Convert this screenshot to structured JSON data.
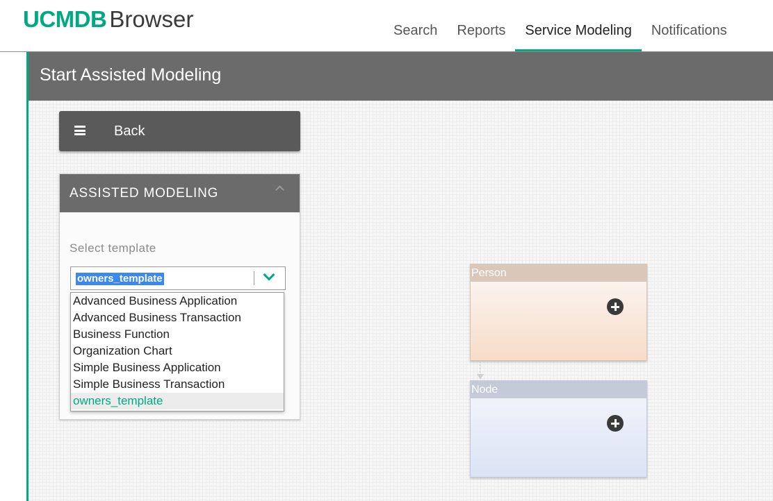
{
  "app": {
    "brand": "UCMDB",
    "product": "Browser"
  },
  "nav": {
    "items": [
      {
        "label": "Search",
        "active": false
      },
      {
        "label": "Reports",
        "active": false
      },
      {
        "label": "Service Modeling",
        "active": true
      },
      {
        "label": "Notifications",
        "active": false
      }
    ]
  },
  "page": {
    "title": "Start Assisted Modeling"
  },
  "back_button": {
    "label": "Back",
    "icon": "hamburger-icon"
  },
  "panel": {
    "title": "ASSISTED MODELING",
    "collapse_icon": "chevron-up-icon",
    "select_label": "Select template",
    "select_value": "owners_template",
    "dropdown_options": [
      "Advanced Business Application",
      "Advanced Business Transaction",
      "Business Function",
      "Organization Chart",
      "Simple Business Application",
      "Simple Business Transaction",
      "owners_template"
    ],
    "selected_index": 6
  },
  "model": {
    "nodes": [
      {
        "label": "Person",
        "action_icon": "plus-circle-icon"
      },
      {
        "label": "Node",
        "action_icon": "plus-circle-icon"
      }
    ]
  },
  "colors": {
    "accent": "#01a982",
    "header_gray": "#6b6b6b",
    "selection_blue": "#3b88ef"
  }
}
